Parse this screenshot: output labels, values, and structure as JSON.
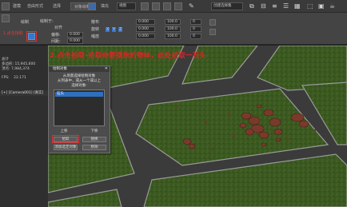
{
  "menubar": {
    "tabs": [
      "建模",
      "自由形式",
      "选择",
      "对象绘制",
      "填充"
    ],
    "active_tab": "对象绘制",
    "view_dropdown": "视图",
    "selection_set": "创建选择集"
  },
  "ribbon": {
    "paint_label": "绘制",
    "paint_on_label": "绘制于:",
    "offset_label": "偏移:",
    "offset_value": "0.000",
    "align_label": "对齐",
    "spacing_label": "间距:",
    "spacing_value": "0.000",
    "scatter_label": "散布",
    "rotate_label": "旋转",
    "scale_label": "缩放",
    "rot_x": "0.000",
    "rot_y": "0.000",
    "rot_z": "0.000",
    "axis_x": "X",
    "axis_y": "Y",
    "axis_z": "Z",
    "scale_vals": [
      "100.0",
      "100.0",
      "100.0"
    ],
    "lock_vals": [
      "0",
      "0",
      "0"
    ],
    "pick_hint": "1.点击拾取"
  },
  "left_panel": {
    "header": "[+] [Camera001] [真实]",
    "rows": [
      {
        "label": "总计",
        "value": ""
      },
      {
        "label": "多边形:",
        "value": "15,945,600"
      },
      {
        "label": "顶点:",
        "value": "7,984,374"
      },
      {
        "label": "FPS:",
        "value": "22.171"
      }
    ]
  },
  "instruction": "2.点击拾取-拾取你要摆放的物体，此处拾取一石头",
  "dialog": {
    "title": "绘制对象",
    "text_lines": [
      "从场景选择绘制对象",
      "从列表中，或从一个或以上",
      "选择对象:"
    ],
    "list_items": [
      "石头"
    ],
    "btn_up": "上移",
    "btn_down": "下移",
    "btn_pick": "拾取",
    "btn_add_selected": "添加选定对象",
    "btn_replace": "替换",
    "btn_remove": "移除"
  },
  "colors": {
    "grass": "#3b5a1f",
    "road": "#3d3d3d",
    "curb": "#9a9a9a",
    "rock": "#7b3c2d",
    "accent_red": "#e02424",
    "selection_blue": "#2f6fbf"
  }
}
